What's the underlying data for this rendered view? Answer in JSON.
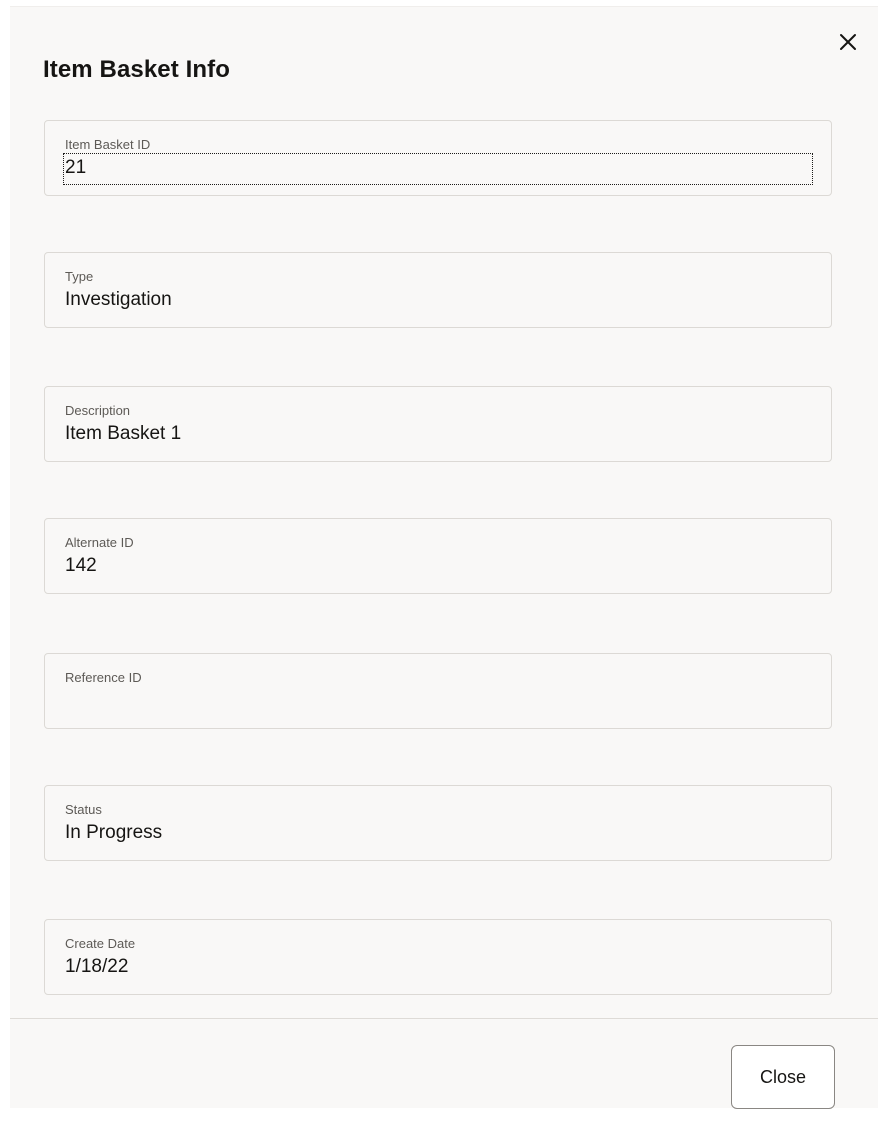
{
  "dialog": {
    "title": "Item Basket Info",
    "close_icon": "close-icon",
    "close_button_label": "Close"
  },
  "fields": {
    "item_basket_id": {
      "label": "Item Basket ID",
      "value": "21"
    },
    "type": {
      "label": "Type",
      "value": "Investigation"
    },
    "description": {
      "label": "Description",
      "value": "Item Basket 1"
    },
    "alternate_id": {
      "label": "Alternate ID",
      "value": "142"
    },
    "reference_id": {
      "label": "Reference ID",
      "value": ""
    },
    "status": {
      "label": "Status",
      "value": "In Progress"
    },
    "create_date": {
      "label": "Create Date",
      "value": "1/18/22"
    }
  },
  "colors": {
    "dialog_background": "#f9f8f7",
    "field_border": "#dcd9d5",
    "text_primary": "#161513",
    "text_label": "#5d5a56"
  }
}
